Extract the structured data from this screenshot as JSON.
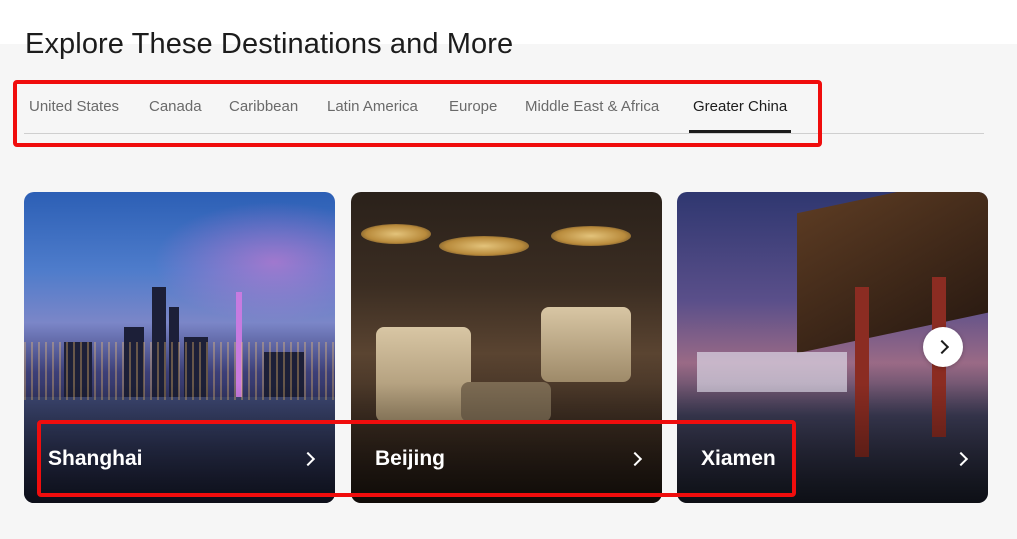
{
  "section": {
    "title": "Explore These Destinations and More"
  },
  "tabs": [
    {
      "label": "United States",
      "active": false
    },
    {
      "label": "Canada",
      "active": false
    },
    {
      "label": "Caribbean",
      "active": false
    },
    {
      "label": "Latin America",
      "active": false
    },
    {
      "label": "Europe",
      "active": false
    },
    {
      "label": "Middle East & Africa",
      "active": false
    },
    {
      "label": "Greater China",
      "active": true
    }
  ],
  "cards": [
    {
      "name": "Shanghai",
      "icon": "chevron-right-icon"
    },
    {
      "name": "Beijing",
      "icon": "chevron-right-icon"
    },
    {
      "name": "Xiamen",
      "icon": "chevron-right-icon"
    }
  ],
  "carousel": {
    "next_icon": "chevron-right-icon"
  },
  "colors": {
    "highlight": "#f00d0d",
    "text": "#1c1c1c",
    "tab_inactive": "#6a6a6a"
  }
}
